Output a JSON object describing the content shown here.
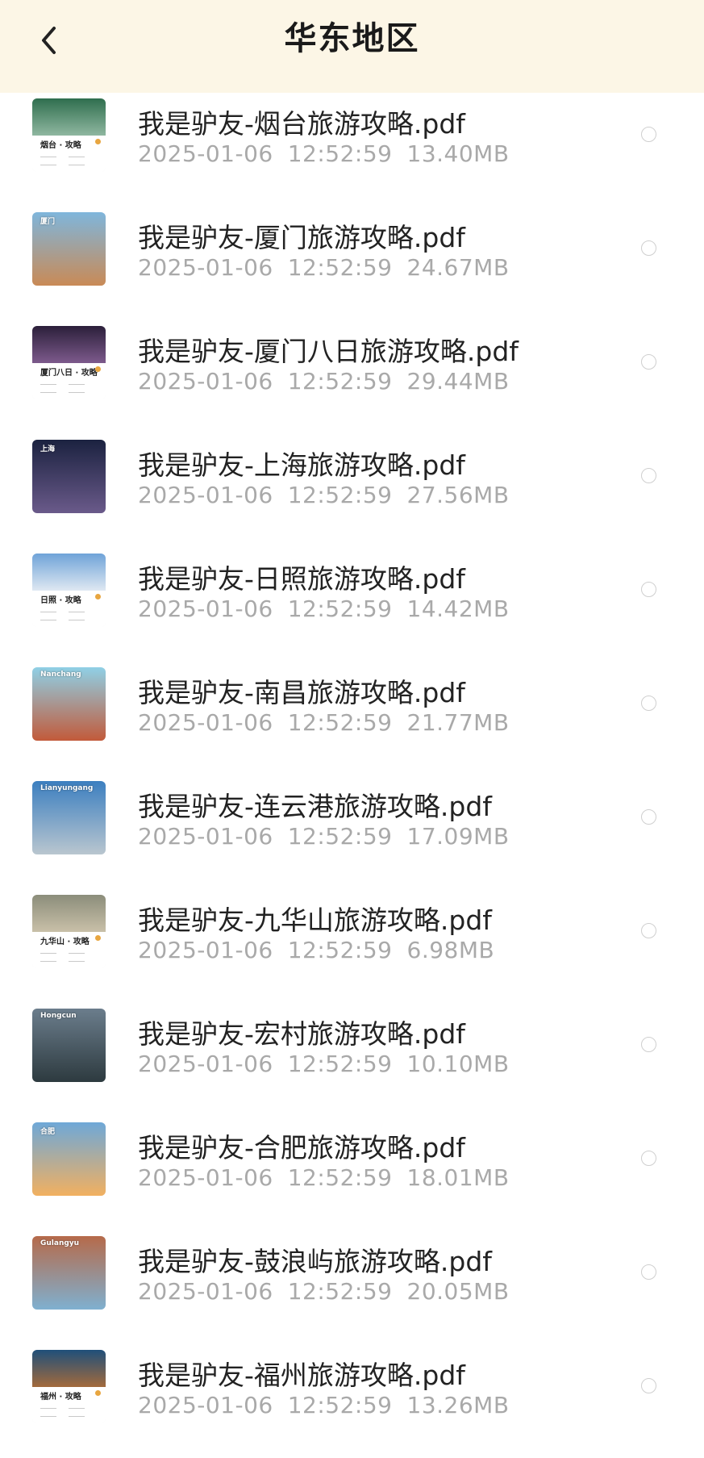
{
  "header": {
    "title": "华东地区"
  },
  "colors": {
    "header_bg": "#fcf6e6",
    "meta_text": "#a9a9a9",
    "name_text": "#222222"
  },
  "icons": {
    "back": "chevron-left-icon",
    "select": "radio-circle-icon"
  },
  "files": [
    {
      "name": "我是驴友-烟台旅游攻略.pdf",
      "date": "2025-01-06",
      "time": "12:52:59",
      "size": "13.40MB",
      "cover": "烟台 · 攻略"
    },
    {
      "name": "我是驴友-厦门旅游攻略.pdf",
      "date": "2025-01-06",
      "time": "12:52:59",
      "size": "24.67MB",
      "cover": "厦门"
    },
    {
      "name": "我是驴友-厦门八日旅游攻略.pdf",
      "date": "2025-01-06",
      "time": "12:52:59",
      "size": "29.44MB",
      "cover": "厦门八日 · 攻略"
    },
    {
      "name": "我是驴友-上海旅游攻略.pdf",
      "date": "2025-01-06",
      "time": "12:52:59",
      "size": "27.56MB",
      "cover": "上海"
    },
    {
      "name": "我是驴友-日照旅游攻略.pdf",
      "date": "2025-01-06",
      "time": "12:52:59",
      "size": "14.42MB",
      "cover": "日照 · 攻略"
    },
    {
      "name": "我是驴友-南昌旅游攻略.pdf",
      "date": "2025-01-06",
      "time": "12:52:59",
      "size": "21.77MB",
      "cover": "Nanchang"
    },
    {
      "name": "我是驴友-连云港旅游攻略.pdf",
      "date": "2025-01-06",
      "time": "12:52:59",
      "size": "17.09MB",
      "cover": "Lianyungang"
    },
    {
      "name": "我是驴友-九华山旅游攻略.pdf",
      "date": "2025-01-06",
      "time": "12:52:59",
      "size": "6.98MB",
      "cover": "九华山 · 攻略"
    },
    {
      "name": "我是驴友-宏村旅游攻略.pdf",
      "date": "2025-01-06",
      "time": "12:52:59",
      "size": "10.10MB",
      "cover": "Hongcun"
    },
    {
      "name": "我是驴友-合肥旅游攻略.pdf",
      "date": "2025-01-06",
      "time": "12:52:59",
      "size": "18.01MB",
      "cover": "合肥"
    },
    {
      "name": "我是驴友-鼓浪屿旅游攻略.pdf",
      "date": "2025-01-06",
      "time": "12:52:59",
      "size": "20.05MB",
      "cover": "Gulangyu"
    },
    {
      "name": "我是驴友-福州旅游攻略.pdf",
      "date": "2025-01-06",
      "time": "12:52:59",
      "size": "13.26MB",
      "cover": "福州 · 攻略"
    }
  ]
}
